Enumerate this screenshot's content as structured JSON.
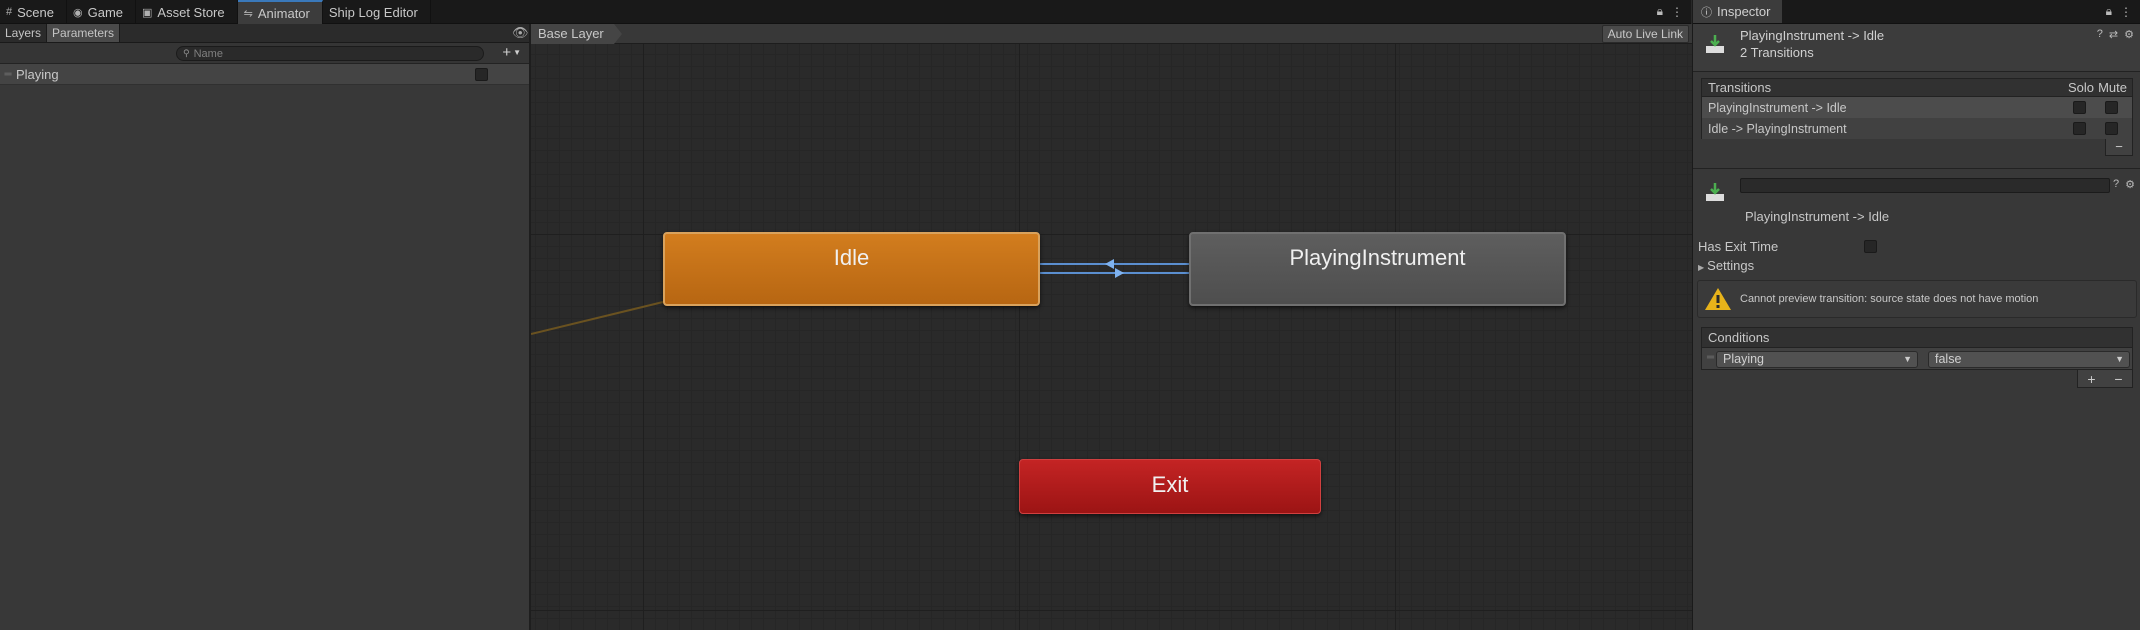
{
  "tabs": [
    {
      "label": "Scene",
      "icon": "grid-icon"
    },
    {
      "label": "Game",
      "icon": "gamepad-icon"
    },
    {
      "label": "Asset Store",
      "icon": "bag-icon"
    },
    {
      "label": "Animator",
      "icon": "animator-icon",
      "active": true
    },
    {
      "label": "Ship Log Editor",
      "icon": ""
    }
  ],
  "left_panel": {
    "tabs": [
      "Layers",
      "Parameters"
    ],
    "active_tab": "Parameters",
    "search_placeholder": "Name",
    "parameters": [
      {
        "name": "Playing",
        "type": "bool",
        "value": false
      }
    ]
  },
  "graph": {
    "breadcrumb": "Base Layer",
    "auto_live_link": "Auto Live Link",
    "states": {
      "idle": "Idle",
      "playing": "PlayingInstrument",
      "exit": "Exit"
    }
  },
  "inspector": {
    "tab_label": "Inspector",
    "title": "PlayingInstrument -> Idle",
    "subtitle": "2 Transitions",
    "transitions_header": "Transitions",
    "solo_label": "Solo",
    "mute_label": "Mute",
    "transitions": [
      {
        "label": "PlayingInstrument -> Idle",
        "selected": true
      },
      {
        "label": "Idle -> PlayingInstrument",
        "selected": false
      }
    ],
    "transition_label": "PlayingInstrument -> Idle",
    "has_exit_time_label": "Has Exit Time",
    "settings_label": "Settings",
    "warning": "Cannot preview transition: source state does not have motion",
    "conditions_header": "Conditions",
    "condition": {
      "parameter": "Playing",
      "value": "false"
    }
  },
  "colors": {
    "accent": "#3a79bb",
    "idle_state": "#c8731a",
    "playing_state": "#555555",
    "exit_state": "#b31c1c",
    "warning": "#e8b31a"
  }
}
